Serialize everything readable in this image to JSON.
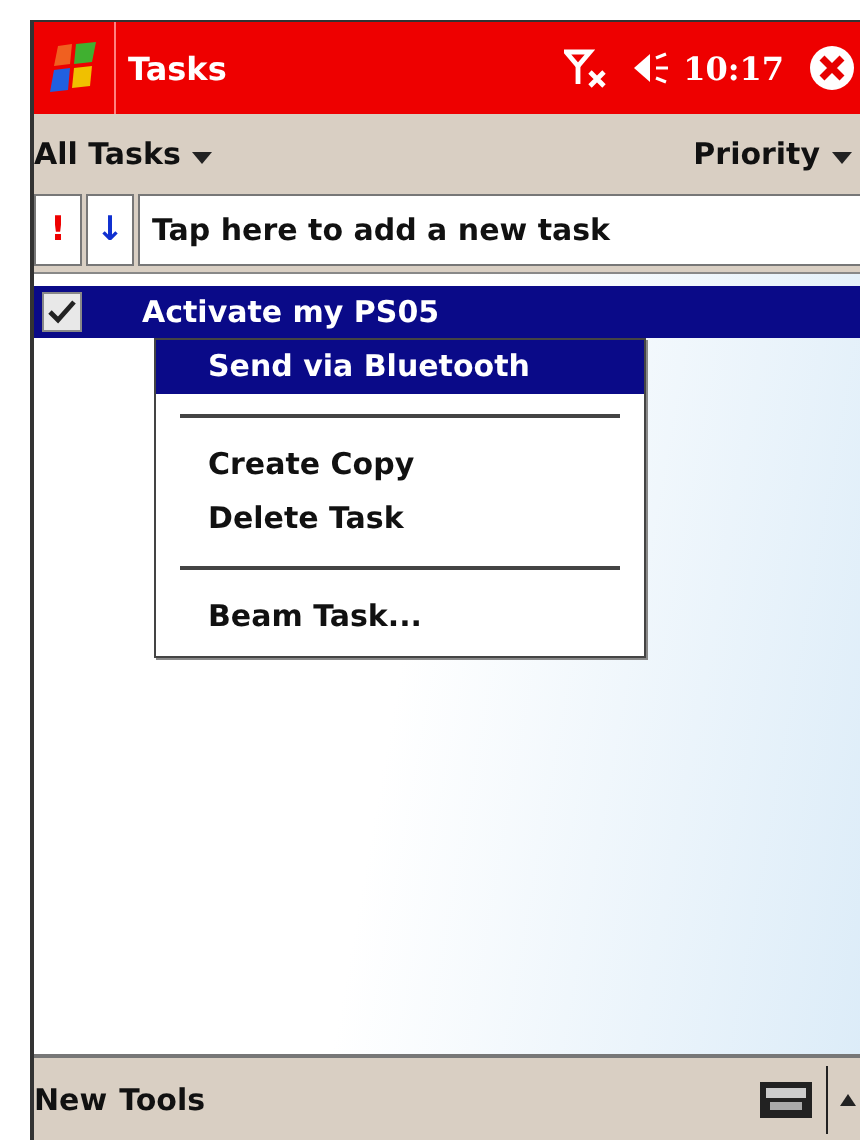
{
  "title_bar": {
    "title": "Tasks",
    "time": "10:17"
  },
  "filter_bar": {
    "category": "All Tasks",
    "sort": "Priority"
  },
  "entry_bar": {
    "priority_key": "!",
    "sort_key": "↓",
    "placeholder": "Tap here to add a new task"
  },
  "tasks": [
    {
      "name": "Activate my PS05",
      "checked": true,
      "selected": true
    }
  ],
  "context_menu": [
    {
      "kind": "item",
      "label": "Send via Bluetooth",
      "selected": true
    },
    {
      "kind": "separator"
    },
    {
      "kind": "item",
      "label": "Create Copy",
      "selected": false
    },
    {
      "kind": "item",
      "label": "Delete Task",
      "selected": false
    },
    {
      "kind": "separator"
    },
    {
      "kind": "item",
      "label": "Beam Task...",
      "selected": false
    }
  ],
  "menu_bar": {
    "items": [
      "New",
      "Tools"
    ]
  }
}
